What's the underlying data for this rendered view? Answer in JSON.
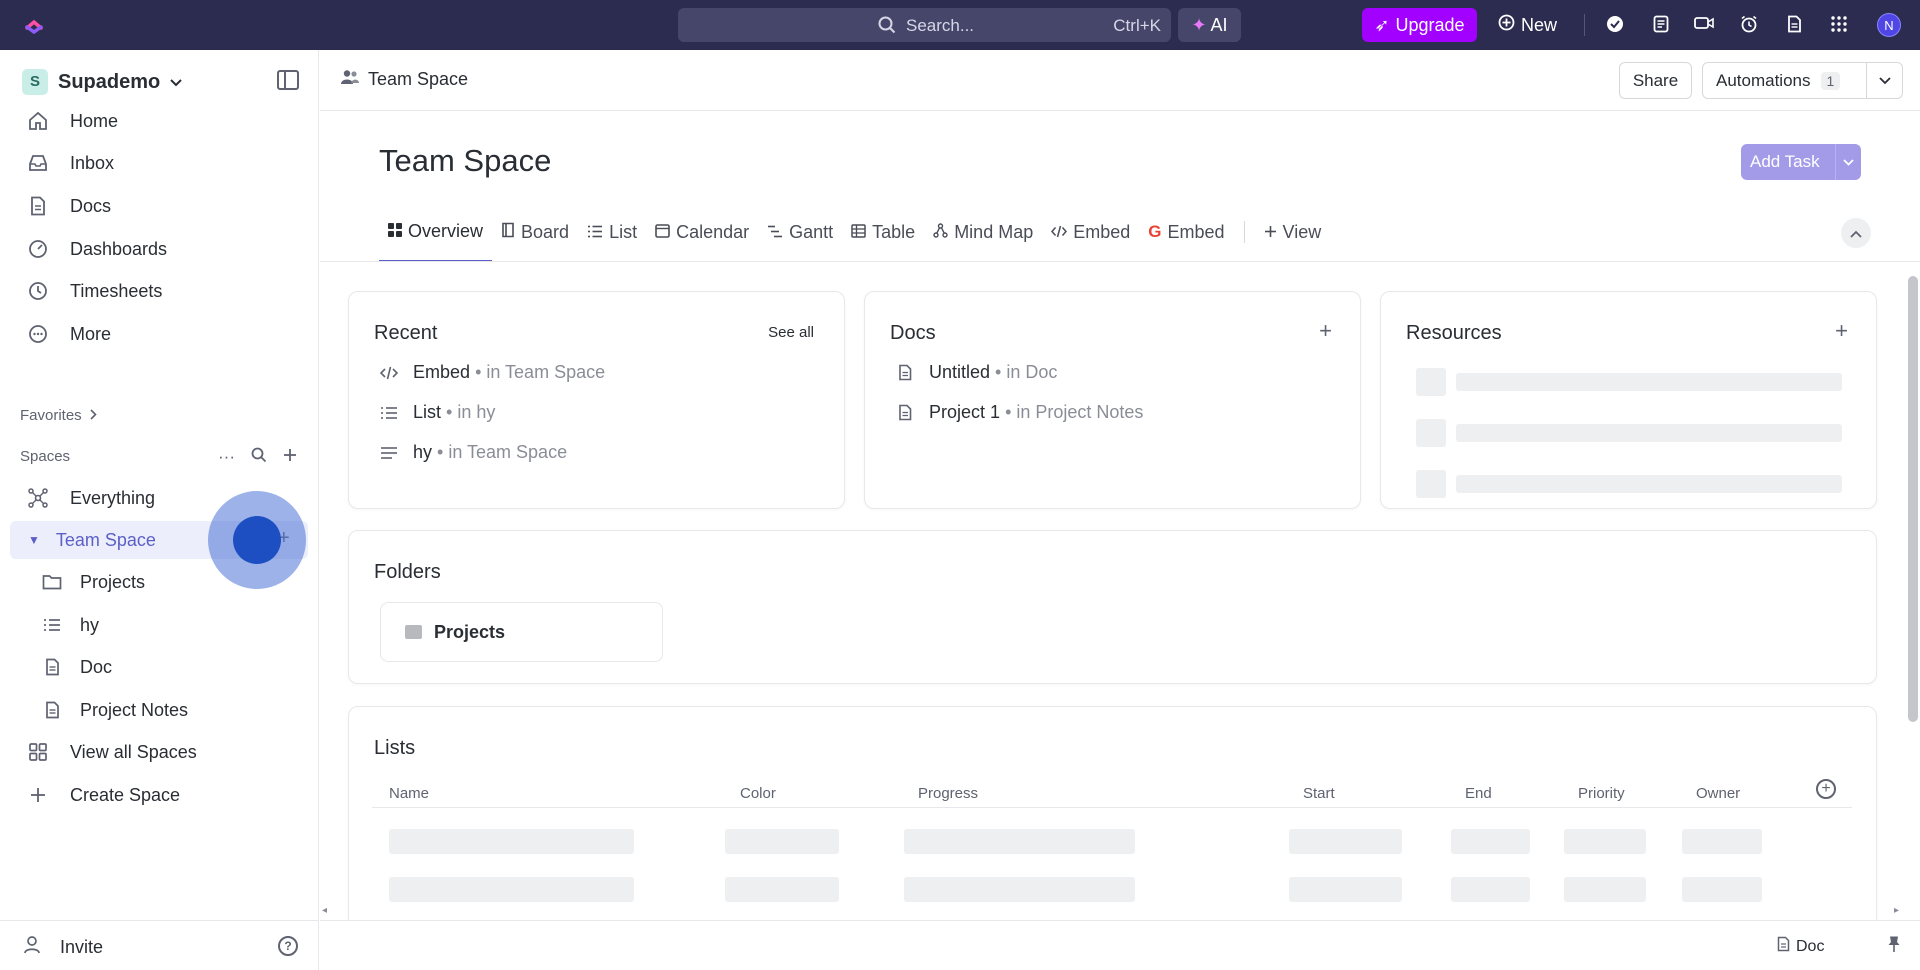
{
  "topbar": {
    "search_placeholder": "Search...",
    "search_shortcut": "Ctrl+K",
    "ai_label": "AI",
    "upgrade_label": "Upgrade",
    "new_label": "New",
    "avatar_initial": "N"
  },
  "sidebar": {
    "workspace_initial": "S",
    "workspace_name": "Supademo",
    "nav": [
      {
        "label": "Home",
        "icon": "home-icon"
      },
      {
        "label": "Inbox",
        "icon": "inbox-icon"
      },
      {
        "label": "Docs",
        "icon": "docs-icon"
      },
      {
        "label": "Dashboards",
        "icon": "dashboards-icon"
      },
      {
        "label": "Timesheets",
        "icon": "timesheets-icon"
      },
      {
        "label": "More",
        "icon": "more-icon"
      }
    ],
    "favorites_label": "Favorites",
    "spaces_label": "Spaces",
    "everything_label": "Everything",
    "team_space_label": "Team Space",
    "team_children": [
      {
        "label": "Projects",
        "icon": "folder-icon"
      },
      {
        "label": "hy",
        "icon": "list-icon"
      },
      {
        "label": "Doc",
        "icon": "doc-icon"
      },
      {
        "label": "Project Notes",
        "icon": "doc-icon"
      }
    ],
    "view_all_label": "View all Spaces",
    "create_label": "Create Space",
    "invite_label": "Invite"
  },
  "header": {
    "breadcrumb": "Team Space",
    "share_label": "Share",
    "automations_label": "Automations",
    "automations_count": "1"
  },
  "page": {
    "title": "Team Space",
    "add_task_label": "Add Task",
    "tabs": [
      {
        "label": "Overview",
        "icon": "overview-icon",
        "active": true
      },
      {
        "label": "Board",
        "icon": "board-icon"
      },
      {
        "label": "List",
        "icon": "list-icon"
      },
      {
        "label": "Calendar",
        "icon": "calendar-icon"
      },
      {
        "label": "Gantt",
        "icon": "gantt-icon"
      },
      {
        "label": "Table",
        "icon": "table-icon"
      },
      {
        "label": "Mind Map",
        "icon": "mindmap-icon"
      },
      {
        "label": "Embed",
        "icon": "embed-icon"
      },
      {
        "label": "Embed",
        "icon": "google-icon"
      }
    ],
    "add_view_label": "View"
  },
  "recent": {
    "title": "Recent",
    "see_all": "See all",
    "items": [
      {
        "name": "Embed",
        "location": "• in Team Space"
      },
      {
        "name": "List",
        "location": "• in hy"
      },
      {
        "name": "hy",
        "location": "• in Team Space"
      }
    ]
  },
  "docs": {
    "title": "Docs",
    "items": [
      {
        "name": "Untitled",
        "location": "• in Doc"
      },
      {
        "name": "Project 1",
        "location": "• in Project Notes"
      }
    ]
  },
  "resources": {
    "title": "Resources"
  },
  "folders": {
    "title": "Folders",
    "items": [
      "Projects"
    ]
  },
  "lists": {
    "title": "Lists",
    "columns": [
      "Name",
      "Color",
      "Progress",
      "Start",
      "End",
      "Priority",
      "Owner"
    ]
  },
  "footer": {
    "doc_label": "Doc"
  },
  "colors": {
    "accent": "#5b5fc7",
    "topbar": "#2b2c4f",
    "upgrade": "#a200ff"
  }
}
